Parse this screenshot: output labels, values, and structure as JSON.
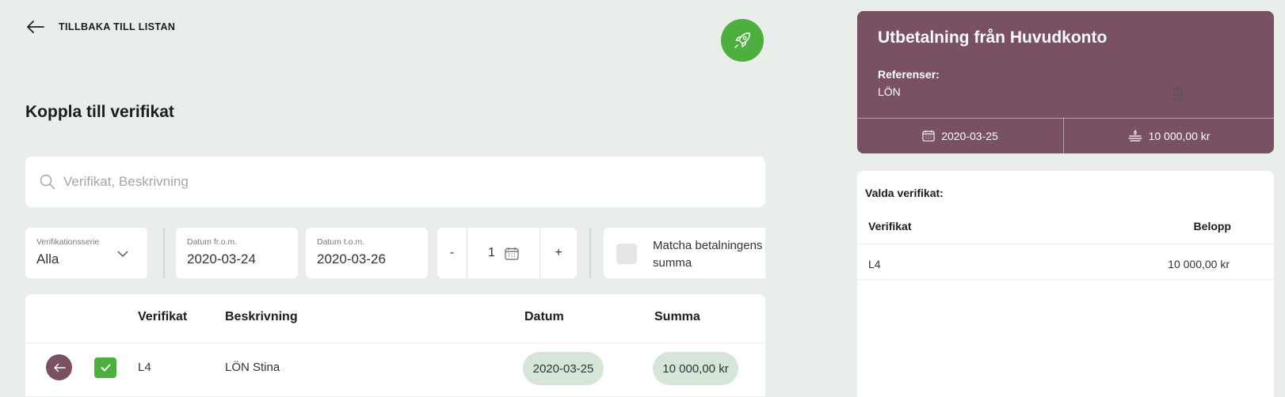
{
  "nav": {
    "back_label": "TILLBAKA TILL LISTAN"
  },
  "page": {
    "title": "Koppla till verifikat"
  },
  "search": {
    "placeholder": "Verifikat, Beskrivning",
    "value": ""
  },
  "filters": {
    "series": {
      "label": "Verifikationsserie",
      "value": "Alla"
    },
    "date_from": {
      "label": "Datum fr.o.m.",
      "value": "2020-03-24"
    },
    "date_to": {
      "label": "Datum t.o.m.",
      "value": "2020-03-26"
    },
    "stepper": {
      "minus": "-",
      "value": "1",
      "plus": "+"
    },
    "match": {
      "label_line1": "Matcha betalningens",
      "label_line2": "summa"
    }
  },
  "table": {
    "headers": {
      "verifikat": "Verifikat",
      "beskrivning": "Beskrivning",
      "datum": "Datum",
      "summa": "Summa"
    },
    "rows": [
      {
        "verifikat": "L4",
        "beskrivning": "LÖN Stina",
        "datum": "2020-03-25",
        "summa": "10 000,00 kr",
        "selected": true
      }
    ]
  },
  "payment": {
    "title": "Utbetalning från Huvudkonto",
    "ref_label": "Referenser:",
    "ref_value": "LÖN",
    "date": "2020-03-25",
    "amount": "10 000,00 kr"
  },
  "selected": {
    "title": "Valda verifikat:",
    "col_verifikat": "Verifikat",
    "col_belopp": "Belopp",
    "rows": [
      {
        "verifikat": "L4",
        "belopp": "10 000,00 kr"
      }
    ]
  },
  "colors": {
    "background": "#e9eeea",
    "accent_green": "#4caf3e",
    "card_purple": "#7a5163",
    "pill_green": "#d5e5d8"
  },
  "icons": [
    "arrow-left-icon",
    "rocket-icon",
    "search-icon",
    "chevron-down-icon",
    "calendar-icon",
    "check-icon",
    "money-icon",
    "trash-icon"
  ]
}
